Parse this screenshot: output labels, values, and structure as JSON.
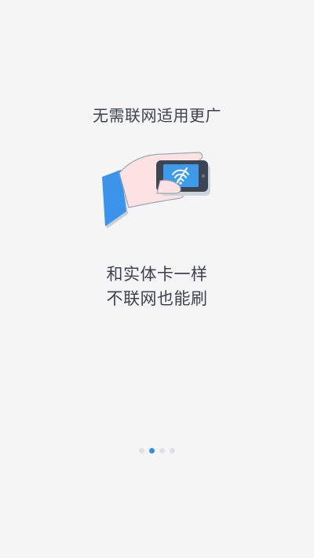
{
  "onboarding": {
    "headline": "无需联网适用更广",
    "illustration_icon": "hand-holding-phone-offline-wifi-icon",
    "caption_line1": "和实体卡一样",
    "caption_line2": "不联网也能刷",
    "pager": {
      "total": 4,
      "current": 2
    }
  },
  "colors": {
    "background": "#f5f5f6",
    "text": "#3f4150",
    "accent": "#2b8fe4",
    "dot_inactive": "#dfe0e3",
    "sleeve": "#3b93ea",
    "skin": "#fde2e4",
    "phone_body": "#3c4554",
    "phone_screen": "#3d9be9"
  }
}
